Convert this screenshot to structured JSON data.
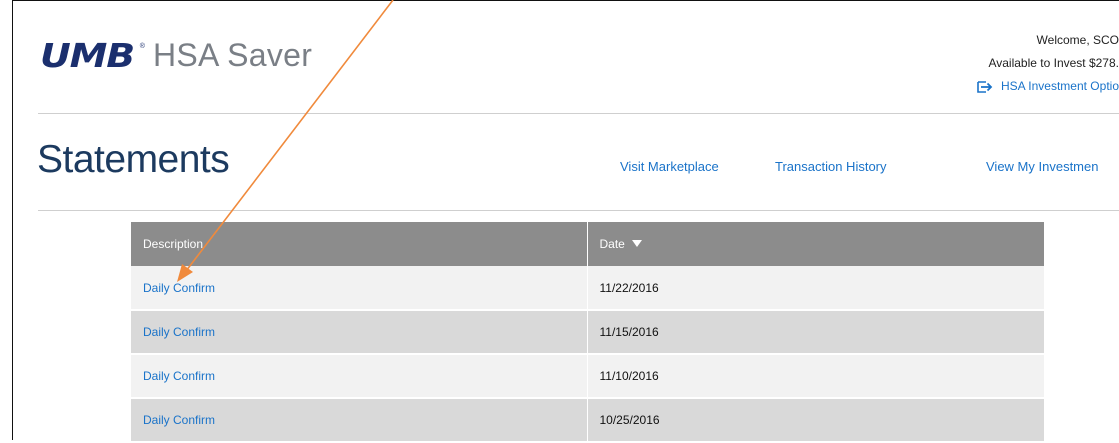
{
  "header": {
    "logo_mark": "UMB",
    "logo_registered": "®",
    "product_name": "HSA Saver"
  },
  "account": {
    "welcome": "Welcome, SCO",
    "available": "Available to Invest $278.",
    "investment_link": "HSA Investment Optio",
    "investment_icon": "arrow-into-box-icon"
  },
  "page": {
    "title": "Statements"
  },
  "nav": {
    "items": [
      {
        "label": "Visit Marketplace"
      },
      {
        "label": "Transaction History"
      },
      {
        "label": "View My Investmen"
      }
    ]
  },
  "table": {
    "headers": {
      "description": "Description",
      "date": "Date"
    },
    "sort_icon": "sort-descending-icon",
    "rows": [
      {
        "description": "Daily Confirm",
        "date": "11/22/2016"
      },
      {
        "description": "Daily Confirm",
        "date": "11/15/2016"
      },
      {
        "description": "Daily Confirm",
        "date": "11/10/2016"
      },
      {
        "description": "Daily Confirm",
        "date": "10/25/2016"
      }
    ]
  },
  "colors": {
    "link": "#1a73c9",
    "title": "#1c3a5f",
    "logo": "#1b2f6e",
    "table_header": "#8c8c8c",
    "row_light": "#f2f2f2",
    "row_dark": "#d9d9d9",
    "annotation_arrow": "#f08a3c"
  }
}
